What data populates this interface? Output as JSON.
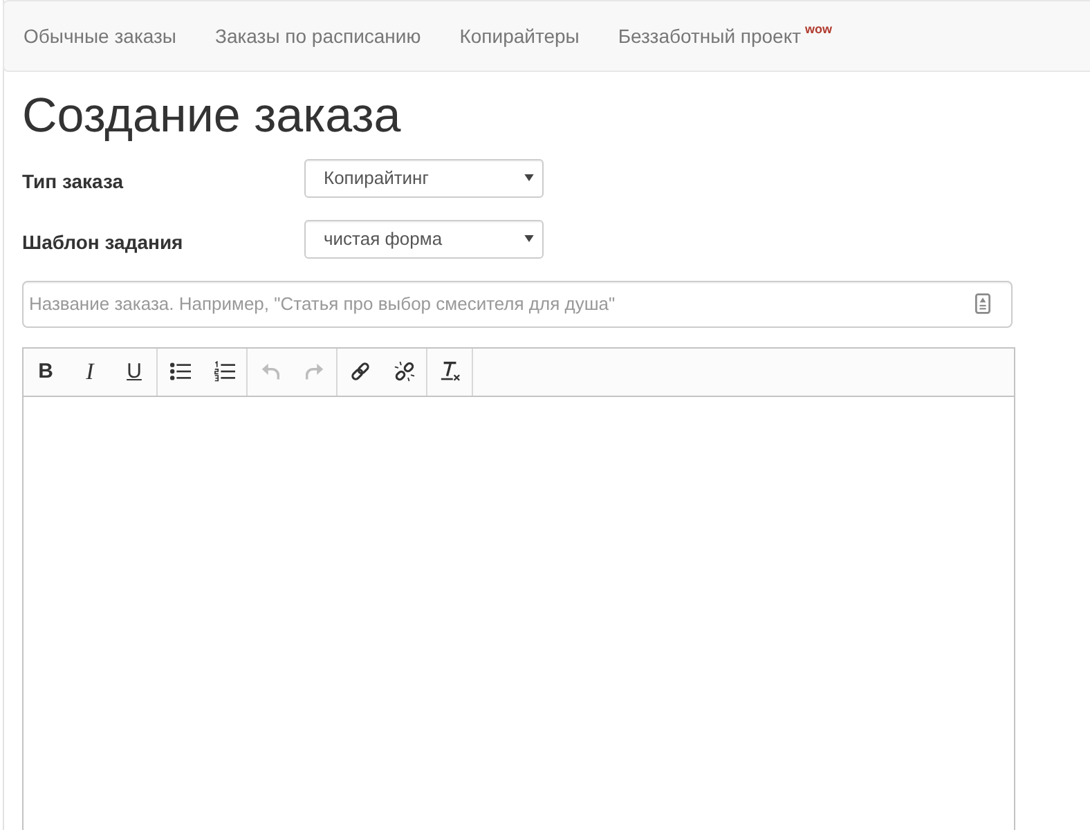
{
  "navbar": {
    "items": [
      {
        "label": "Обычные заказы"
      },
      {
        "label": "Заказы по расписанию"
      },
      {
        "label": "Копирайтеры"
      },
      {
        "label": "Беззаботный проект",
        "badge": "wow"
      }
    ]
  },
  "page": {
    "title": "Создание заказа"
  },
  "form": {
    "fields": [
      {
        "label": "Тип заказа",
        "value": "Копирайтинг"
      },
      {
        "label": "Шаблон задания",
        "value": "чистая форма"
      }
    ],
    "order_title": {
      "placeholder": "Название заказа. Например, \"Статья про выбор смесителя для душа\""
    }
  },
  "editor": {
    "toolbar": [
      {
        "buttons": [
          {
            "kind": "bold",
            "label": "B",
            "disabled": false
          },
          {
            "kind": "italic",
            "label": "I",
            "disabled": false
          },
          {
            "kind": "underline",
            "label": "U",
            "disabled": false
          }
        ]
      },
      {
        "buttons": [
          {
            "kind": "bullets",
            "disabled": false
          },
          {
            "kind": "numbers",
            "disabled": false
          }
        ]
      },
      {
        "buttons": [
          {
            "kind": "undo",
            "disabled": true
          },
          {
            "kind": "redo",
            "disabled": true
          }
        ]
      },
      {
        "buttons": [
          {
            "kind": "link",
            "disabled": false
          },
          {
            "kind": "unlink",
            "disabled": false
          }
        ]
      },
      {
        "buttons": [
          {
            "kind": "clear_format",
            "disabled": false
          }
        ]
      }
    ]
  }
}
